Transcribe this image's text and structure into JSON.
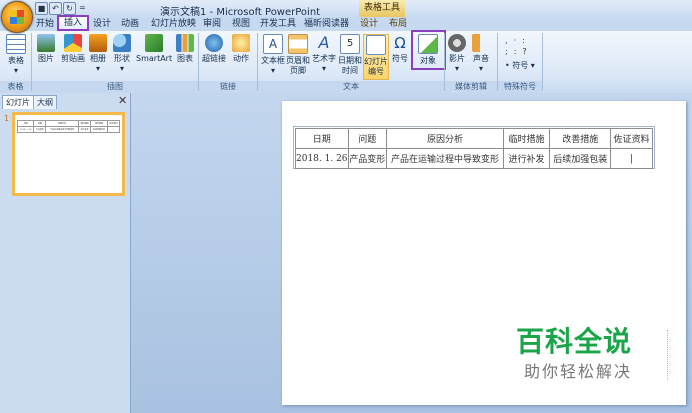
{
  "window": {
    "title": "演示文稿1 - Microsoft PowerPoint",
    "context_tab_group": "表格工具"
  },
  "quick_access": {
    "save": "■",
    "undo": "↶",
    "redo": "↻",
    "customize": "="
  },
  "tabs": [
    {
      "label": "开始"
    },
    {
      "label": "插入",
      "active": true
    },
    {
      "label": "设计"
    },
    {
      "label": "动画"
    },
    {
      "label": "幻灯片放映"
    },
    {
      "label": "审阅"
    },
    {
      "label": "视图"
    },
    {
      "label": "开发工具"
    },
    {
      "label": "福昕阅读器"
    },
    {
      "label": "设计",
      "contextual": true
    },
    {
      "label": "布局",
      "contextual": true
    }
  ],
  "ribbon": {
    "groups": [
      {
        "label": "表格"
      },
      {
        "label": "插图"
      },
      {
        "label": "链接"
      },
      {
        "label": "文本"
      },
      {
        "label": "媒体剪辑"
      },
      {
        "label": "特殊符号"
      }
    ],
    "buttons": {
      "table": "表格",
      "picture": "图片",
      "clipart": "剪贴画",
      "album": "相册",
      "shapes": "形状",
      "smartart": "SmartArt",
      "chart": "图表",
      "hyperlink": "超链接",
      "action": "动作",
      "textbox_1": "文本框",
      "header_footer_1": "页眉和",
      "header_footer_2": "页脚",
      "wordart": "艺术字",
      "datetime_1": "日期和",
      "datetime_2": "时间",
      "slide_number_1": "幻灯片",
      "slide_number_2": "编号",
      "symbol": "符号",
      "object": "对象",
      "movie": "影片",
      "sound": "声音",
      "special_symbol": "符号"
    },
    "colors": {
      "highlight": "#8b3fbf"
    }
  },
  "left_pane": {
    "tabs": [
      "幻灯片",
      "大纲"
    ],
    "close": "✕",
    "slide_number": "1"
  },
  "slide_table": {
    "headers": [
      "日期",
      "问题",
      "原因分析",
      "临时措施",
      "改善措施",
      "佐证资料"
    ],
    "rows": [
      [
        "2018. 1. 26",
        "产品变形",
        "产品在运输过程中导致变形",
        "进行补发",
        "后续加强包装",
        "|"
      ]
    ]
  },
  "watermark": {
    "main": "百科全说",
    "sub": "助你轻松解决"
  }
}
